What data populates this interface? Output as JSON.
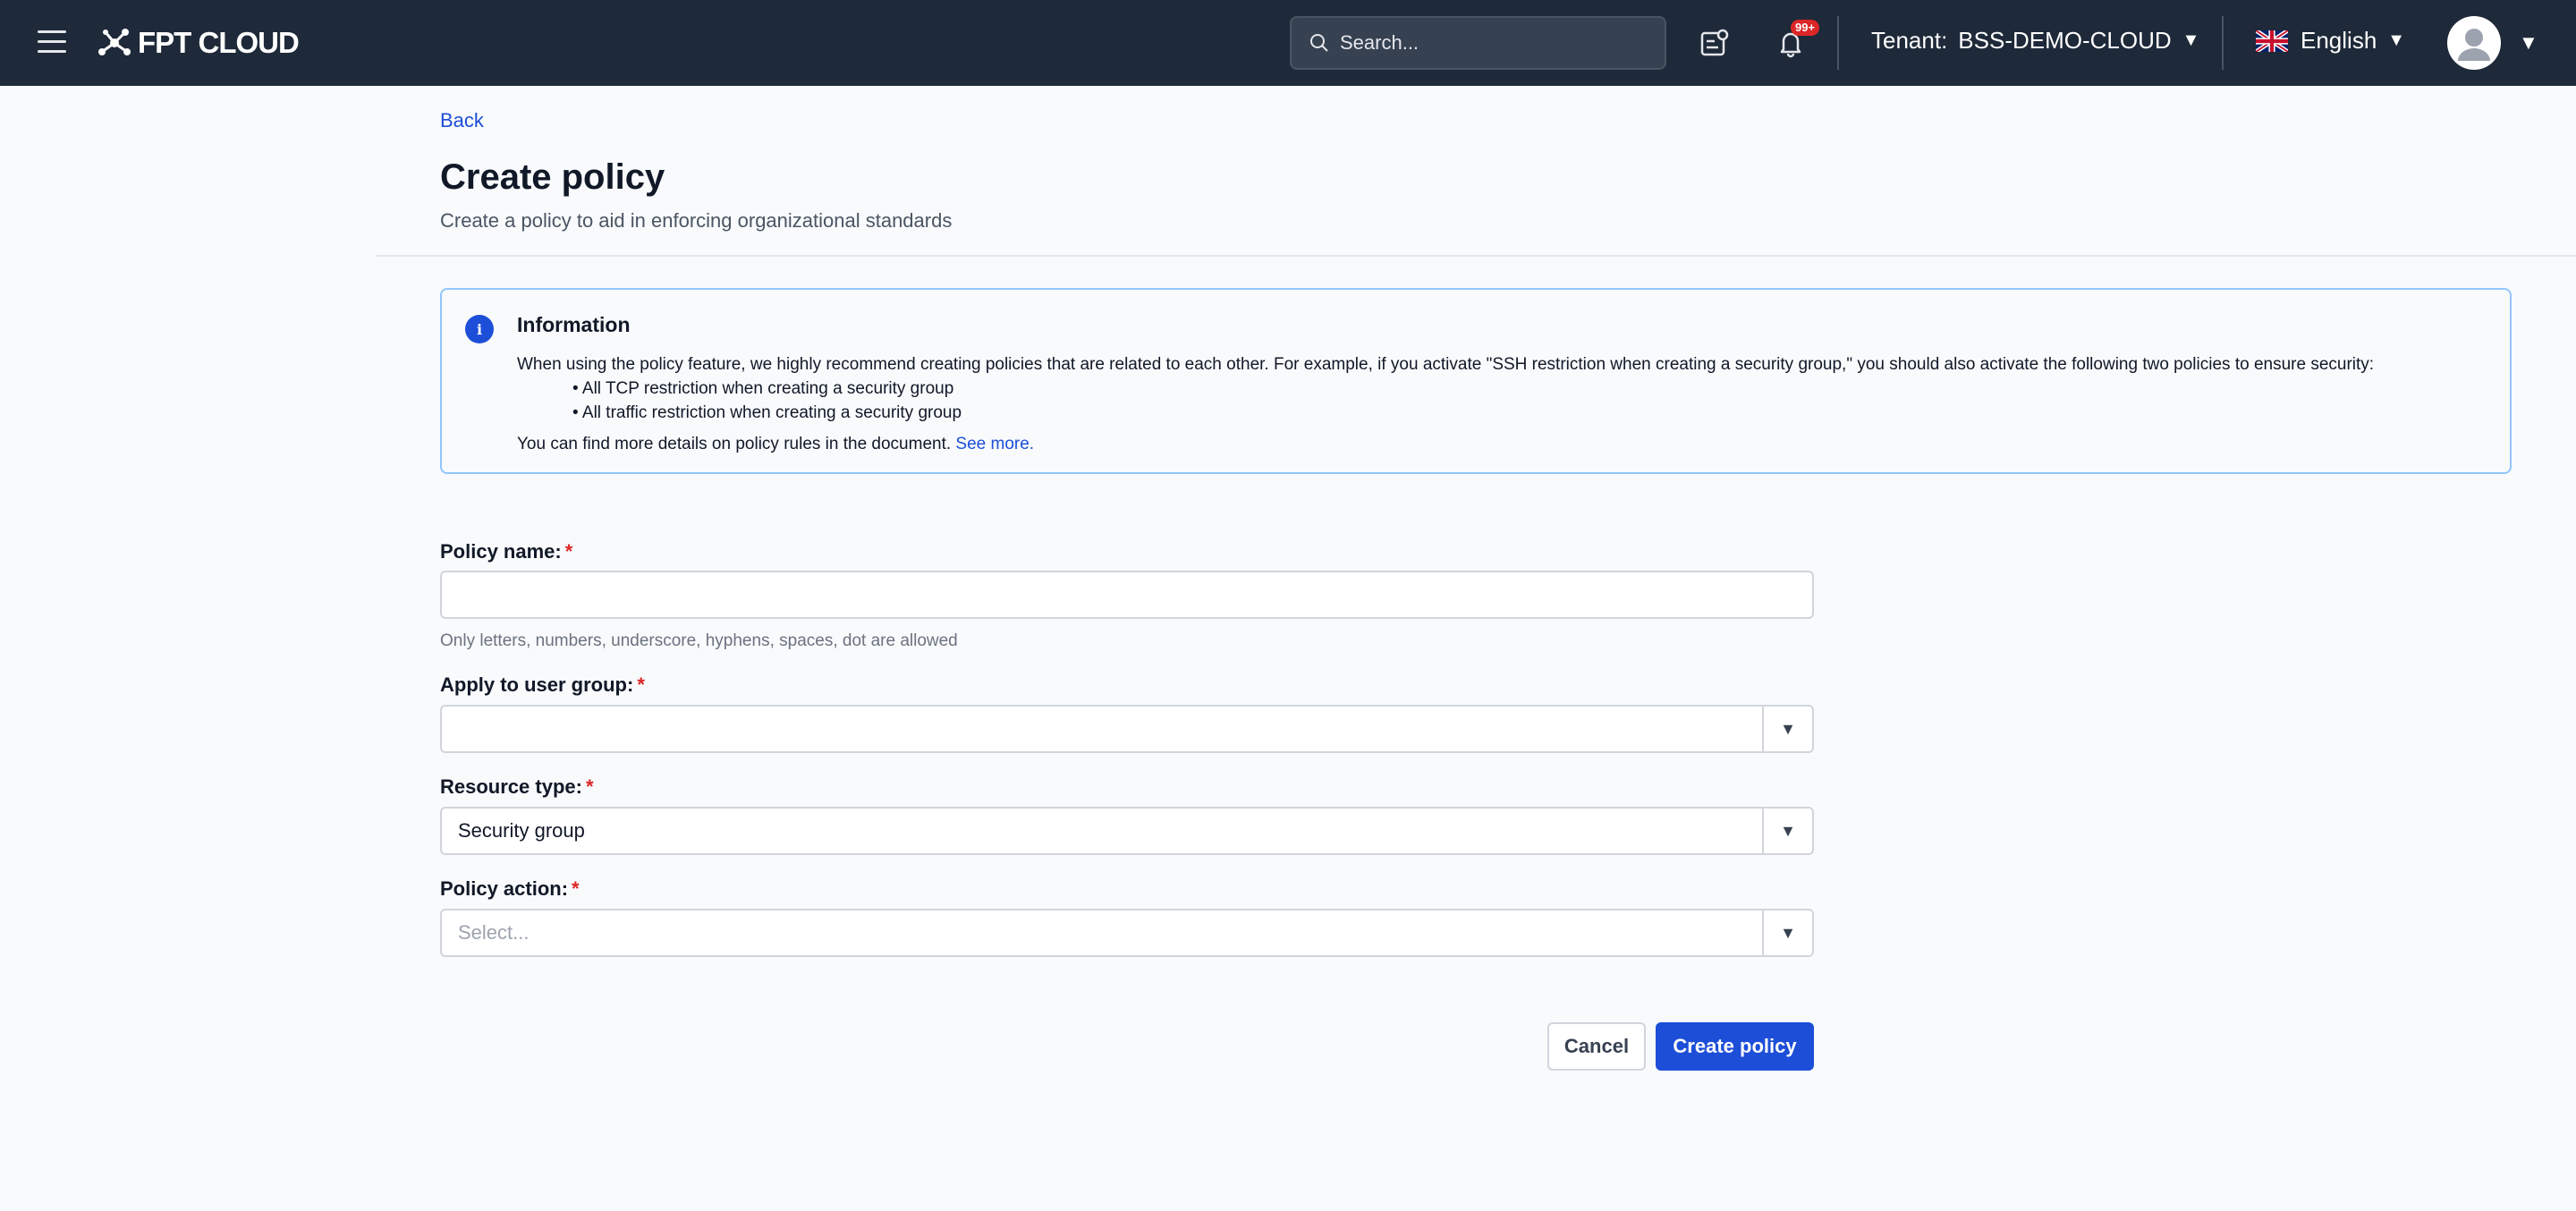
{
  "topbar": {
    "brand": "FPT CLOUD",
    "search_placeholder": "Search...",
    "notification_badge": "99+",
    "tenant_label": "Tenant:",
    "tenant_value": "BSS-DEMO-CLOUD",
    "language": "English"
  },
  "header": {
    "back": "Back",
    "title": "Create policy",
    "subtitle": "Create a policy to aid in enforcing organizational standards"
  },
  "info": {
    "title": "Information",
    "body": "When using the policy feature, we highly recommend creating policies that are related to each other. For example, if you activate \"SSH restriction when creating a security group,\" you should also activate the following two policies to ensure security:",
    "items": [
      "All TCP restriction when creating a security group",
      "All traffic restriction when creating a security group"
    ],
    "footer": "You can find more details on policy rules in the document.",
    "link": "See more."
  },
  "form": {
    "policy_name_label": "Policy name:",
    "policy_name_value": "",
    "policy_name_hint": "Only letters, numbers, underscore, hyphens, spaces, dot are allowed",
    "user_group_label": "Apply to user group:",
    "user_group_value": "",
    "resource_type_label": "Resource type:",
    "resource_type_value": "Security group",
    "policy_action_label": "Policy action:",
    "policy_action_placeholder": "Select...",
    "required_mark": "*"
  },
  "actions": {
    "cancel": "Cancel",
    "create": "Create policy"
  },
  "colors": {
    "topbar": "#1e2939",
    "primary": "#1d4ed8",
    "required": "#dc2626",
    "info_border": "#93c5fd"
  }
}
